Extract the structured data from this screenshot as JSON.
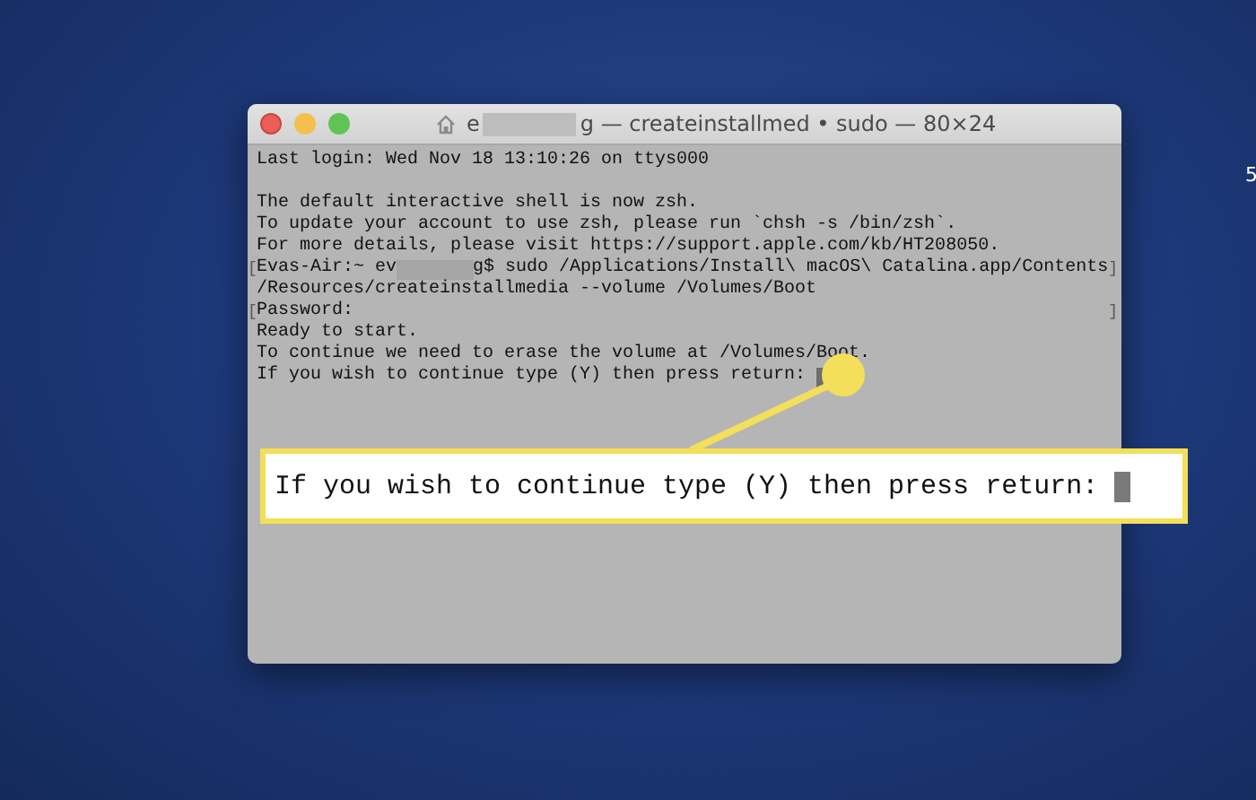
{
  "window": {
    "title_start": "e",
    "title_end": "g — createinstallmed • sudo — 80×24"
  },
  "terminal": {
    "lines": [
      {
        "kind": "text",
        "text": "Last login: Wed Nov 18 13:10:26 on ttys000"
      },
      {
        "kind": "blank"
      },
      {
        "kind": "text",
        "text": "The default interactive shell is now zsh."
      },
      {
        "kind": "text",
        "text": "To update your account to use zsh, please run `chsh -s /bin/zsh`."
      },
      {
        "kind": "text",
        "text": "For more details, please visit https://support.apple.com/kb/HT208050."
      },
      {
        "kind": "prompt",
        "left_mark": "[",
        "text": "Evas-Air:~ ev",
        "text_after": "g$ sudo /Applications/Install\\ macOS\\ Catalina.app/Contents",
        "right_mark": "]"
      },
      {
        "kind": "text",
        "text": "/Resources/createinstallmedia --volume /Volumes/Boot"
      },
      {
        "kind": "text",
        "left_mark": "[",
        "text": "Password:",
        "right_mark": "]"
      },
      {
        "kind": "text",
        "text": "Ready to start."
      },
      {
        "kind": "text",
        "text": "To continue we need to erase the volume at /Volumes/Boot."
      },
      {
        "kind": "input",
        "text": "If you wish to continue type (Y) then press return:"
      }
    ]
  },
  "callout": {
    "text": "If you wish to continue type (Y) then press return:"
  },
  "desktop": {
    "label": "5"
  }
}
